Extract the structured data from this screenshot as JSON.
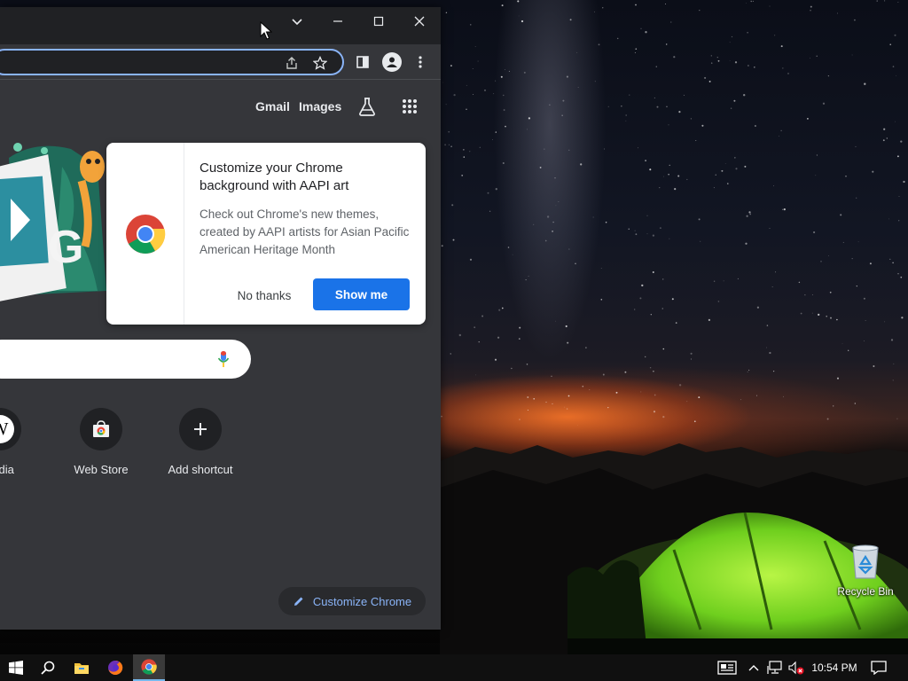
{
  "browser": {
    "header_links": {
      "gmail": "Gmail",
      "images": "Images"
    },
    "shortcuts": [
      {
        "label": "pedia",
        "icon": "wikipedia-icon"
      },
      {
        "label": "Web Store",
        "icon": "web-store-icon"
      },
      {
        "label": "Add shortcut",
        "icon": "plus-icon"
      }
    ],
    "customize_button": "Customize Chrome",
    "promo": {
      "title": "Customize your Chrome background with AAPI art",
      "body": "Check out Chrome's new themes, created by AAPI artists for Asian Pacific American Heritage Month",
      "dismiss_label": "No thanks",
      "accept_label": "Show me"
    }
  },
  "desktop": {
    "icons": [
      {
        "label": "Recycle Bin",
        "icon": "recycle-bin-icon"
      }
    ]
  },
  "taskbar": {
    "clock": "10:54 PM",
    "pinned": [
      "windows-start-icon",
      "search-icon",
      "file-explorer-icon",
      "firefox-icon",
      "chrome-icon"
    ],
    "active_app": "chrome-icon"
  },
  "colors": {
    "accent": "#1a73e8",
    "link_blue": "#8ab4f8",
    "ntp_background": "#35363a",
    "titlebar": "#202124",
    "taskbar": "#101010"
  }
}
